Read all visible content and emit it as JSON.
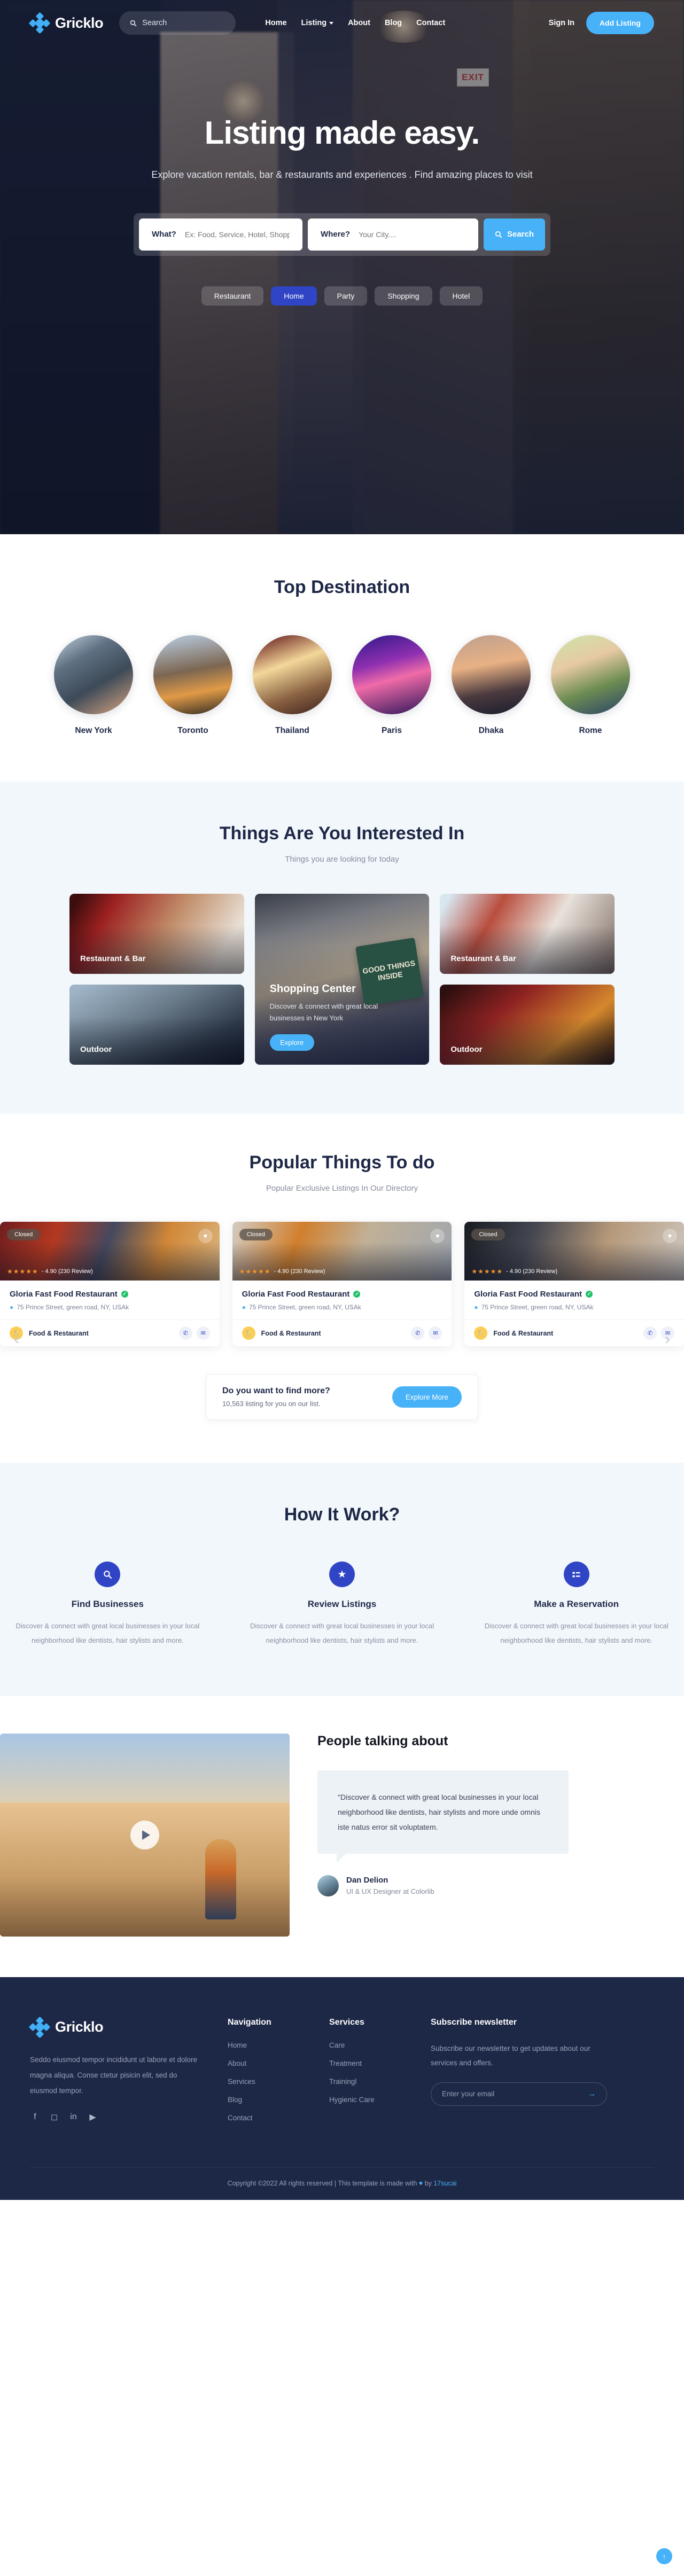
{
  "brand": {
    "name": "Gricklo"
  },
  "nav": {
    "search_placeholder": "Search",
    "links": [
      {
        "label": "Home",
        "caret": false
      },
      {
        "label": "Listing",
        "caret": true
      },
      {
        "label": "About",
        "caret": false
      },
      {
        "label": "Blog",
        "caret": false
      },
      {
        "label": "Contact",
        "caret": false
      }
    ],
    "signin": "Sign In",
    "add_listing": "Add Listing"
  },
  "hero": {
    "title": "Listing made easy.",
    "subtitle": "Explore vacation rentals, bar & restaurants and experiences . Find amazing places to visit",
    "what_label": "What?",
    "what_placeholder": "Ex: Food, Service, Hotel, Shopping",
    "where_label": "Where?",
    "where_placeholder": "Your City....",
    "search_button": "Search",
    "pills": [
      {
        "label": "Restaurant",
        "active": false
      },
      {
        "label": "Home",
        "active": true
      },
      {
        "label": "Party",
        "active": false
      },
      {
        "label": "Shopping",
        "active": false
      },
      {
        "label": "Hotel",
        "active": false
      }
    ]
  },
  "destinations": {
    "title": "Top Destination",
    "items": [
      {
        "name": "New York"
      },
      {
        "name": "Toronto"
      },
      {
        "name": "Thailand"
      },
      {
        "name": "Paris"
      },
      {
        "name": "Dhaka"
      },
      {
        "name": "Rome"
      }
    ]
  },
  "interests": {
    "title": "Things Are You Interested In",
    "subtitle": "Things you are looking for today",
    "cards": [
      {
        "label": "Restaurant & Bar"
      },
      {
        "label": "Restaurant & Bar"
      },
      {
        "label": "Outdoor"
      },
      {
        "label": "Outdoor"
      }
    ],
    "featured": {
      "sign_text": "GOOD THINGS INSIDE",
      "title": "Shopping Center",
      "description": "Discover & connect with great local businesses in New York",
      "button": "Explore"
    }
  },
  "popular": {
    "title": "Popular Things To do",
    "subtitle": "Popular Exclusive Listings In Our Directory",
    "prev_icon": "chevron-left",
    "next_icon": "chevron-right",
    "cards": [
      {
        "status": "Closed",
        "rating_stars": "★★★★★",
        "rating_text": "- 4.90 (230 Review)",
        "name": "Gloria Fast Food Restaurant",
        "address": "75 Prince Street, green road, NY, USAk",
        "category": "Food & Restaurant"
      },
      {
        "status": "Closed",
        "rating_stars": "★★★★★",
        "rating_text": "- 4.90 (230 Review)",
        "name": "Gloria Fast Food Restaurant",
        "address": "75 Prince Street, green road, NY, USAk",
        "category": "Food & Restaurant"
      },
      {
        "status": "Closed",
        "rating_stars": "★★★★★",
        "rating_text": "- 4.90 (230 Review)",
        "name": "Gloria Fast Food Restaurant",
        "address": "75 Prince Street, green road, NY, USAk",
        "category": "Food & Restaurant"
      }
    ],
    "findmore": {
      "title": "Do you want to find more?",
      "subtitle": "10,563 listing for you on our list.",
      "button": "Explore More"
    }
  },
  "howit": {
    "title": "How It Work?",
    "steps": [
      {
        "icon": "search-icon",
        "title": "Find Businesses",
        "desc": "Discover & connect with great local businesses in your local neighborhood like dentists, hair stylists and more."
      },
      {
        "icon": "star-badge-icon",
        "title": "Review Listings",
        "desc": "Discover & connect with great local businesses in your local neighborhood like dentists, hair stylists and more."
      },
      {
        "icon": "list-icon",
        "title": "Make a Reservation",
        "desc": "Discover & connect with great local businesses in your local neighborhood like dentists, hair stylists and more."
      }
    ]
  },
  "talk": {
    "title": "People talking about",
    "quote": "\"Discover & connect with great local businesses in your local neighborhood like dentists, hair stylists and more unde omnis iste natus error sit voluptatem.",
    "author_name": "Dan Delion",
    "author_role": "UI & UX Designer at Colorlib"
  },
  "footer": {
    "description": "Seddo eiusmod tempor incididunt ut labore et dolore magna aliqua. Conse ctetur pisicin elit, sed do eiusmod tempor.",
    "socials": [
      "facebook-icon",
      "instagram-icon",
      "linkedin-icon",
      "youtube-icon"
    ],
    "nav_head": "Navigation",
    "nav_links": [
      "Home",
      "About",
      "Services",
      "Blog",
      "Contact"
    ],
    "services_head": "Services",
    "services_links": [
      "Care",
      "Treatment",
      "Trainingl",
      "Hygienic Care"
    ],
    "news_head": "Subscribe newsletter",
    "news_desc": "Subscribe our newsletter to get updates about our services and offers.",
    "news_placeholder": "Enter your email",
    "copyright_pre": "Copyright ©2022 All rights reserved | This template is made with ",
    "copyright_heart": "♥",
    "copyright_mid": " by ",
    "copyright_brand": "17sucai"
  }
}
